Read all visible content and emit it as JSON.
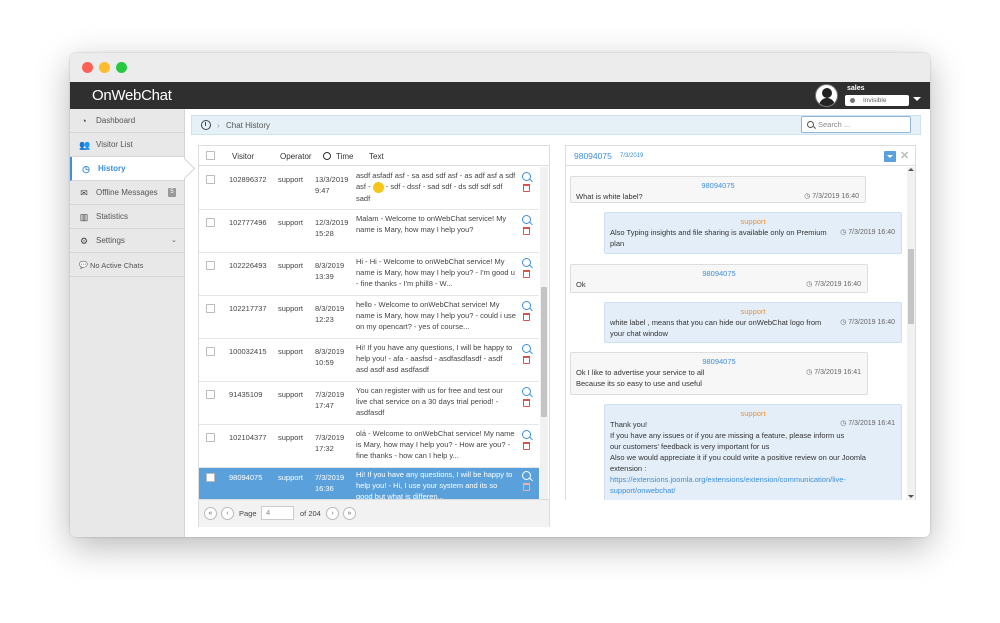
{
  "app": {
    "logo": "OnWebChat",
    "user_name": "sales",
    "status": "Invisible"
  },
  "sidebar": {
    "items": [
      {
        "label": "Dashboard",
        "icon": "dashboard-icon"
      },
      {
        "label": "Visitor List",
        "icon": "users-icon"
      },
      {
        "label": "History",
        "icon": "clock-icon",
        "active": true
      },
      {
        "label": "Offline Messages",
        "icon": "envelope-icon",
        "badge": "5"
      },
      {
        "label": "Statistics",
        "icon": "bar-chart-icon"
      },
      {
        "label": "Settings",
        "icon": "gear-icon"
      }
    ],
    "no_active": "No Active Chats"
  },
  "breadcrumb": {
    "title": "Chat History"
  },
  "search": {
    "placeholder": "Search ..."
  },
  "table": {
    "headers": {
      "visitor": "Visitor",
      "operator": "Operator",
      "time": "Time",
      "text": "Text"
    },
    "rows": [
      {
        "visitor": "102896372",
        "operator": "support",
        "date": "13/3/2019",
        "time": "9:47",
        "text_a": "asdf asfadf asf - sa asd sdf asf - as adf asf a sdf asf - ",
        "text_b": " - sdf - dssf - sad sdf - ds sdf sdf sdf sadf"
      },
      {
        "visitor": "102777496",
        "operator": "support",
        "date": "12/3/2019",
        "time": "15:28",
        "text": "Malam - Welcome to onWebChat service! My name is Mary, how may I help you?"
      },
      {
        "visitor": "102226493",
        "operator": "support",
        "date": "8/3/2019",
        "time": "13:39",
        "text": "Hi - Hi - Welcome to onWebChat service! My name is Mary, how may I help you? - I'm good u - fine thanks - I'm phill8 - W..."
      },
      {
        "visitor": "102217737",
        "operator": "support",
        "date": "8/3/2019",
        "time": "12:23",
        "text": "hello - Welcome to onWebChat service! My name is Mary, how may I help you? - could i use on my opencart? - yes of course..."
      },
      {
        "visitor": "100032415",
        "operator": "support",
        "date": "8/3/2019",
        "time": "10:59",
        "text": "Hi! If you have any questions, I will be happy to help you! - afa - aasfsd - asdfasdfasdf - asdf asd asdf asd asdfasdf"
      },
      {
        "visitor": "91435109",
        "operator": "support",
        "date": "7/3/2019",
        "time": "17:47",
        "text": "You can register with us for free and test our live chat service on a 30 days trial period! - asdfasdf"
      },
      {
        "visitor": "102104377",
        "operator": "support",
        "date": "7/3/2019",
        "time": "17:32",
        "text": "olá - Welcome to onWebChat service! My name is Mary, how may I help you? - How are you? - fine thanks - how can I help y..."
      },
      {
        "visitor": "98094075",
        "operator": "support",
        "date": "7/3/2019",
        "time": "16:36",
        "text": "Hi! If you have any questions, I will be happy to help you! - Hi, I use your system and its so good but what is differen...",
        "selected": true
      }
    ]
  },
  "pager": {
    "page_label": "Page",
    "page_value": "4",
    "of_label": "of 204"
  },
  "chat": {
    "visitor_id": "98094075",
    "date": "7/3/2019",
    "messages": [
      {
        "from": "98094075",
        "time": "7/3/2019 16:40",
        "lines": [
          "What is white label?"
        ],
        "side": "visitor"
      },
      {
        "from": "support",
        "time": "7/3/2019 16:40",
        "lines": [
          "Also Typing insights and file sharing is available only on Premium",
          "plan"
        ],
        "side": "support"
      },
      {
        "from": "98094075",
        "time": "7/3/2019 16:40",
        "lines": [
          "Ok"
        ],
        "side": "visitor"
      },
      {
        "from": "support",
        "time": "7/3/2019 16:40",
        "lines": [
          "white label , means that you can hide our onWebChat logo from",
          "your chat window"
        ],
        "side": "support"
      },
      {
        "from": "98094075",
        "time": "7/3/2019 16:41",
        "lines": [
          "Ok I like to advertise your service to all",
          "Because its so easy to use and useful"
        ],
        "side": "visitor"
      },
      {
        "from": "support",
        "time": "7/3/2019 16:41",
        "lines": [
          "Thank you!",
          "If you have any issues or if you are missing a feature, please inform us",
          "our customers' feedback is very important for us",
          "Also we would appreciate it if you could write a positive review on our Joomla",
          "extension :"
        ],
        "link": [
          "https://extensions.joomla.org/extensions/extension/communication/live-",
          "support/onwebchat/"
        ],
        "side": "support"
      }
    ]
  }
}
